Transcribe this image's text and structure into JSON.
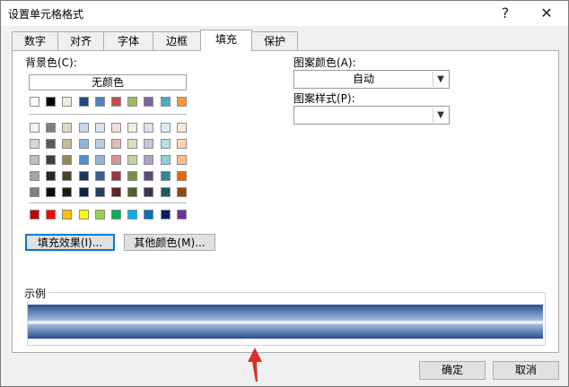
{
  "window": {
    "title": "设置单元格格式",
    "help": "?",
    "close": "✕"
  },
  "tabs": [
    {
      "label": "数字"
    },
    {
      "label": "对齐"
    },
    {
      "label": "字体"
    },
    {
      "label": "边框"
    },
    {
      "label": "填充",
      "active": true
    },
    {
      "label": "保护"
    }
  ],
  "fill": {
    "background_label": "背景色(C):",
    "no_color": "无颜色",
    "fill_effects_button": "填充效果(I)...",
    "more_colors_button": "其他颜色(M)...",
    "pattern_color_label": "图案颜色(A):",
    "pattern_color_value": "自动",
    "pattern_style_label": "图案样式(P):",
    "pattern_style_value": "",
    "sample_label": "示例"
  },
  "palette": {
    "theme_row": [
      "#ffffff",
      "#000000",
      "#eeece1",
      "#1f497d",
      "#4f81bd",
      "#c0504d",
      "#9bbb59",
      "#8064a2",
      "#4bacc6",
      "#f79646"
    ],
    "tints": [
      [
        "#f2f2f2",
        "#7f7f7f",
        "#ddd9c3",
        "#c6d9f0",
        "#dbe5f1",
        "#f2dcdb",
        "#ebf1dd",
        "#e5e0ec",
        "#dbeef3",
        "#fdeada"
      ],
      [
        "#d8d8d8",
        "#595959",
        "#c4bd97",
        "#8db3e2",
        "#b8cce4",
        "#e5b9b7",
        "#d7e3bc",
        "#ccc1d9",
        "#b7dde8",
        "#fbd5b5"
      ],
      [
        "#bfbfbf",
        "#3f3f3f",
        "#938953",
        "#548dd4",
        "#95b3d7",
        "#d99694",
        "#c3d69b",
        "#b2a2c7",
        "#92cddc",
        "#fac08f"
      ],
      [
        "#a5a5a5",
        "#262626",
        "#494429",
        "#17365d",
        "#366092",
        "#953734",
        "#76923c",
        "#5f497a",
        "#31859b",
        "#e36c09"
      ],
      [
        "#7f7f7f",
        "#0c0c0c",
        "#1d1b10",
        "#0f243e",
        "#244061",
        "#632423",
        "#4f6128",
        "#3f3151",
        "#205867",
        "#974806"
      ]
    ],
    "standard_row": [
      "#c00000",
      "#ff0000",
      "#ffc000",
      "#ffff00",
      "#92d050",
      "#00b050",
      "#00b0f0",
      "#0070c0",
      "#002060",
      "#7030a0"
    ]
  },
  "buttons": {
    "ok": "确定",
    "cancel": "取消"
  },
  "colors": {
    "accent": "#0078d7",
    "arrow": "#d9302c"
  }
}
